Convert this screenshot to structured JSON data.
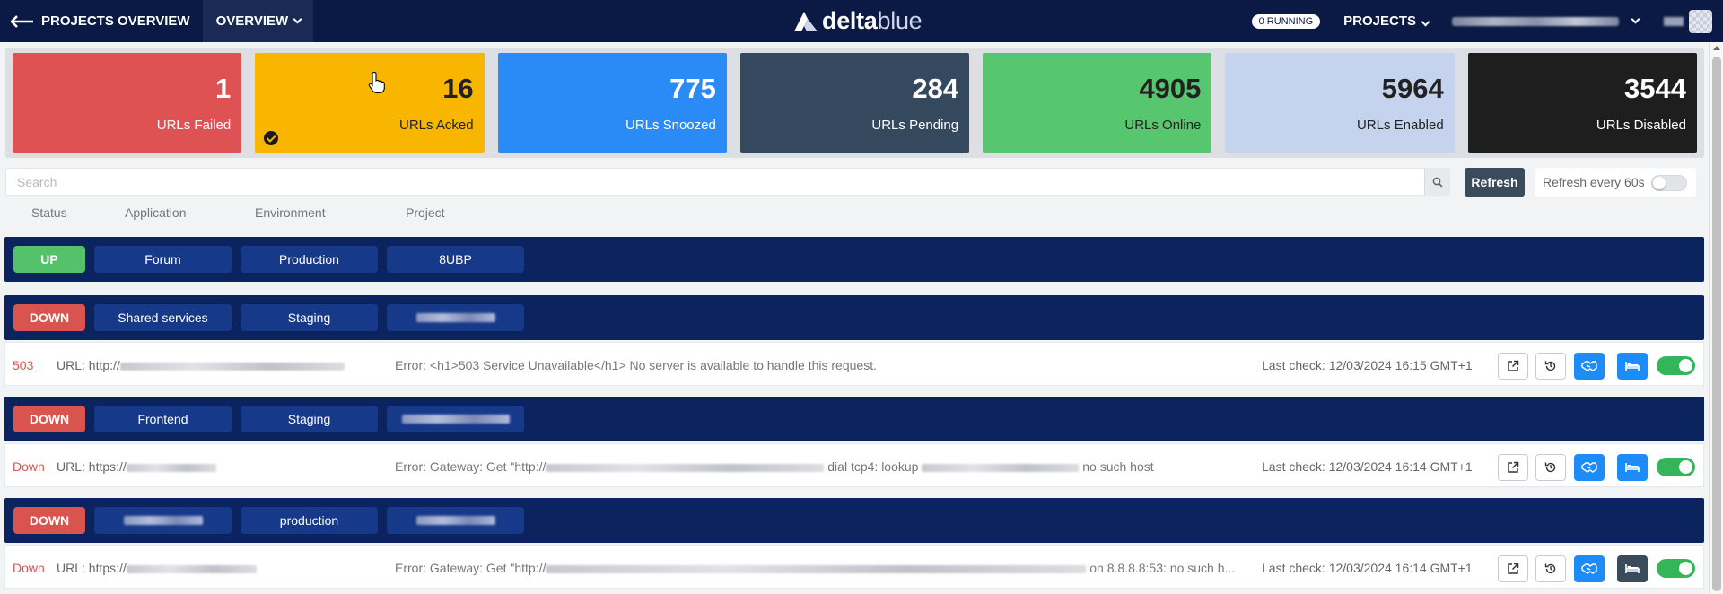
{
  "nav": {
    "back_label": "PROJECTS OVERVIEW",
    "overview_label": "OVERVIEW",
    "logo_delta": "delta",
    "logo_blue": "blue",
    "running_badge": "0 RUNNING",
    "projects_label": "PROJECTS"
  },
  "stats": [
    {
      "value": "1",
      "label": "URLs Failed",
      "bg": "#df5253",
      "fg": "#ffffff"
    },
    {
      "value": "16",
      "label": "URLs Acked",
      "bg": "#f8b600",
      "fg": "#222222"
    },
    {
      "value": "775",
      "label": "URLs Snoozed",
      "bg": "#2a8af6",
      "fg": "#ffffff"
    },
    {
      "value": "284",
      "label": "URLs Pending",
      "bg": "#34495e",
      "fg": "#ffffff"
    },
    {
      "value": "4905",
      "label": "URLs Online",
      "bg": "#58c56f",
      "fg": "#222222"
    },
    {
      "value": "5964",
      "label": "URLs Enabled",
      "bg": "#c6d3ee",
      "fg": "#222222"
    },
    {
      "value": "3544",
      "label": "URLs Disabled",
      "bg": "#1e1e1e",
      "fg": "#ffffff"
    }
  ],
  "search": {
    "placeholder": "Search",
    "value": ""
  },
  "toolbar": {
    "refresh_label": "Refresh",
    "auto_refresh_label": "Refresh every 60s"
  },
  "columns": {
    "status": "Status",
    "application": "Application",
    "environment": "Environment",
    "project": "Project"
  },
  "groups": [
    {
      "status": "UP",
      "application": "Forum",
      "environment": "Production",
      "project": "8UBP"
    },
    {
      "status": "DOWN",
      "application": "Shared services",
      "environment": "Staging",
      "project": ""
    },
    {
      "status": "DOWN",
      "application": "Frontend",
      "environment": "Staging",
      "project": ""
    },
    {
      "status": "DOWN",
      "application": "",
      "environment": "production",
      "project": ""
    }
  ],
  "rows": [
    {
      "code": "503",
      "url_prefix": "URL: http://",
      "error_start": "Error: <h1>503 Service Unavailable</h1> No server is available to handle this request.",
      "error_mid": "",
      "error_end": "",
      "last_check": "Last check: 12/03/2024 16:15 GMT+1"
    },
    {
      "code": "Down",
      "url_prefix": "URL: https://",
      "error_start": "Error: Gateway: Get \"http://",
      "error_mid": "dial tcp4: lookup",
      "error_end": "no such host",
      "last_check": "Last check: 12/03/2024 16:14 GMT+1"
    },
    {
      "code": "Down",
      "url_prefix": "URL: https://",
      "error_start": "Error: Gateway: Get \"http://",
      "error_mid": "",
      "error_end": "on 8.8.8.8:53: no such h...",
      "last_check": "Last check: 12/03/2024 16:14 GMT+1"
    }
  ],
  "icons": {
    "external": "external-link-icon",
    "history": "history-icon",
    "ack": "handshake-icon",
    "snooze": "bed-icon",
    "search": "search-icon"
  },
  "colors": {
    "nav_bg": "#0b1a44",
    "group_bg": "#0b2460",
    "pill_bg": "#17398a",
    "up": "#54c26a",
    "down": "#d9534f",
    "action_blue": "#1d8cf8",
    "toggle_on": "#34b55a"
  }
}
